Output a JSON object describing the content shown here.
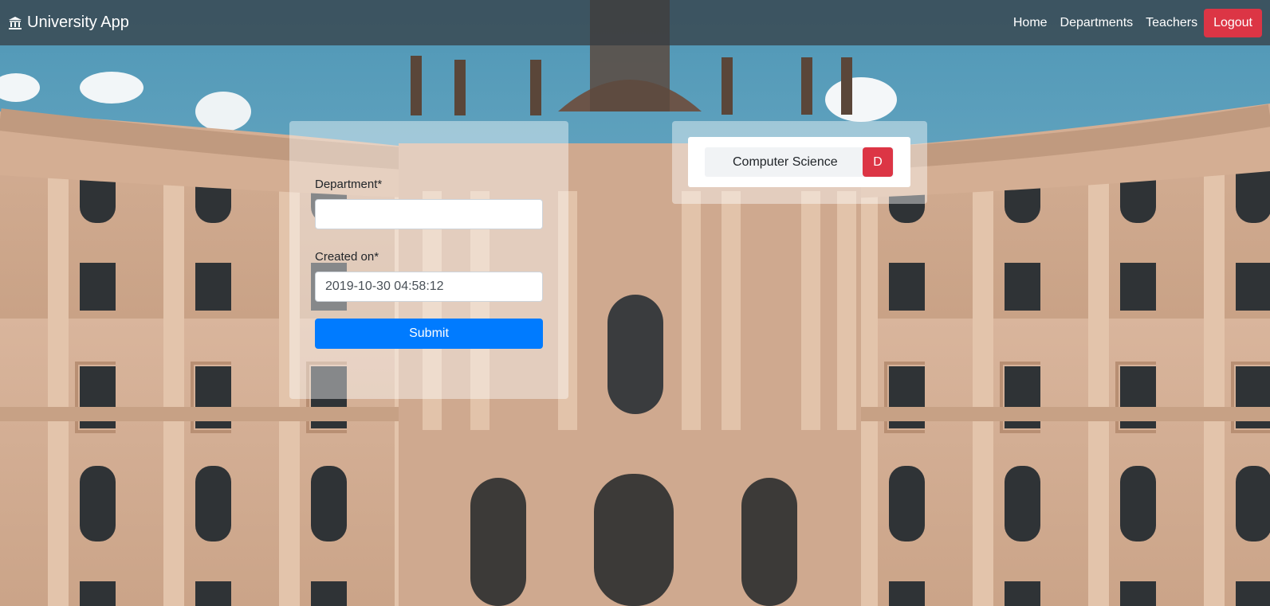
{
  "navbar": {
    "brand_icon": "university-icon",
    "brand": "University App",
    "links": [
      "Home",
      "Departments",
      "Teachers"
    ],
    "logout_label": "Logout"
  },
  "form": {
    "department_label": "Department*",
    "department_value": "",
    "created_label": "Created on*",
    "created_value": "2019-10-30 04:58:12",
    "submit_label": "Submit"
  },
  "departments": {
    "items": [
      {
        "name": "Computer Science",
        "delete_label": "D"
      }
    ]
  },
  "colors": {
    "navbar": "#343a40",
    "primary": "#007bff",
    "danger": "#dc3545"
  }
}
